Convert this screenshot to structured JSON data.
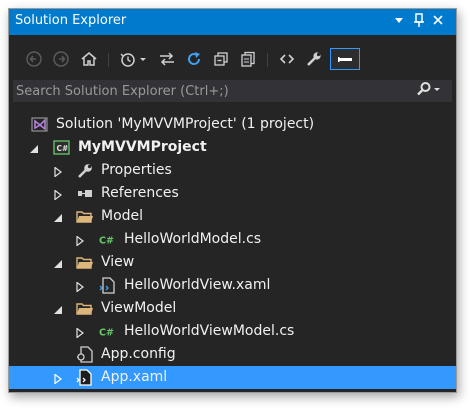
{
  "window": {
    "title": "Solution Explorer",
    "controls": [
      "dropdown-icon",
      "pin-icon",
      "close-icon"
    ]
  },
  "toolbar": {
    "buttons": [
      "back-icon",
      "forward-icon",
      "home-icon",
      "history-icon",
      "sync-icon",
      "refresh-icon",
      "collapse-all-icon",
      "show-all-files-icon",
      "view-code-icon",
      "properties-icon",
      "preview-icon"
    ]
  },
  "search": {
    "placeholder": "Search Solution Explorer (Ctrl+;)"
  },
  "tree": {
    "solution": "Solution 'MyMVVMProject' (1 project)",
    "project": "MyMVVMProject",
    "properties": "Properties",
    "references": "References",
    "model": "Model",
    "model_file": "HelloWorldModel.cs",
    "view": "View",
    "view_file": "HelloWorldView.xaml",
    "viewmodel": "ViewModel",
    "viewmodel_file": "HelloWorldViewModel.cs",
    "app_config": "App.config",
    "app_xaml": "App.xaml"
  },
  "colors": {
    "title_bar": "#007acc",
    "background": "#252526",
    "selection": "#3399ff",
    "folder": "#dcb67a",
    "csharp": "#68c96a"
  }
}
